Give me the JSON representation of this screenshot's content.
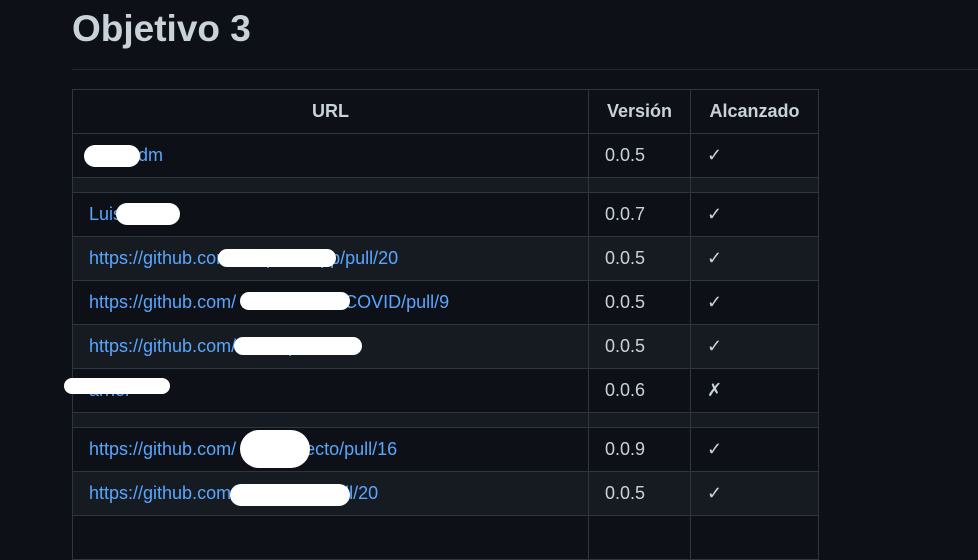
{
  "page": {
    "title": "Objetivo 3"
  },
  "table": {
    "headers": {
      "url": "URL",
      "version": "Versión",
      "achieved": "Alcanzado"
    },
    "rows": [
      {
        "url": "m kngdm",
        "version": "0.0.5",
        "achieved": "✓"
      },
      {
        "url": "",
        "version": "",
        "achieved": ""
      },
      {
        "url": "Luis gui",
        "version": "0.0.7",
        "achieved": "✓"
      },
      {
        "url": "https://github.com/ omparerApp/pull/20",
        "version": "0.0.5",
        "achieved": "✓"
      },
      {
        "url": "https://github.com/ na/Predictor-COVID/pull/9",
        "version": "0.0.5",
        "achieved": "✓"
      },
      {
        "url": "https://github.com/ 18/IV/pull/26",
        "version": "0.0.5",
        "achieved": "✓"
      },
      {
        "url": "arher",
        "version": "0.0.6",
        "achieved": "✗"
      },
      {
        "url": "",
        "version": "",
        "achieved": ""
      },
      {
        "url": "https://github.com/ /IV-Proyecto/pull/16",
        "version": "0.0.9",
        "achieved": "✓"
      },
      {
        "url": "https://github.com/ BarPower/pull/20",
        "version": "0.0.5",
        "achieved": "✓"
      },
      {
        "url": "",
        "version": "",
        "achieved": ""
      }
    ]
  }
}
